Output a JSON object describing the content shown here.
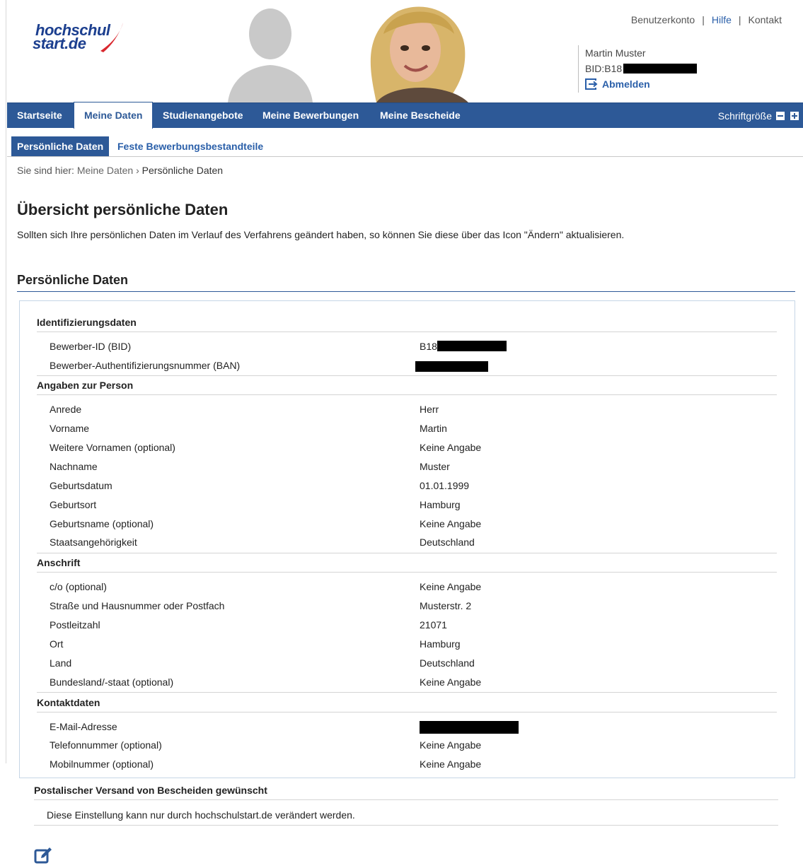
{
  "header": {
    "logo_line1": "hochschul",
    "logo_line2": "start.de",
    "links": {
      "account": "Benutzerkonto",
      "help": "Hilfe",
      "contact": "Kontakt"
    },
    "user_name": "Martin Muster",
    "bid_label": "BID:B18",
    "logout": "Abmelden"
  },
  "main_nav": {
    "items": [
      "Startseite",
      "Meine Daten",
      "Studienangebote",
      "Meine Bewerbungen",
      "Meine Bescheide"
    ],
    "active": "Meine Daten",
    "font_size_label": "Schriftgröße"
  },
  "sub_nav": {
    "items": [
      "Persönliche Daten",
      "Feste Bewerbungsbestandteile"
    ],
    "active": "Persönliche Daten"
  },
  "breadcrumb": {
    "prefix": "Sie sind hier:",
    "parent": "Meine Daten",
    "separator": "›",
    "current": "Persönliche Daten"
  },
  "page": {
    "title": "Übersicht persönliche Daten",
    "intro": "Sollten sich Ihre persönlichen Daten im Verlauf des Verfahrens geändert haben, so können Sie diese über das Icon \"Ändern\" aktualisieren."
  },
  "section_title": "Persönliche Daten",
  "groups": [
    {
      "title": "Identifizierungsdaten",
      "rows": [
        {
          "label": "Bewerber-ID (BID)",
          "value": "B18"
        },
        {
          "label": "Bewerber-Authentifizierungsnummer (BAN)",
          "value": ""
        }
      ]
    },
    {
      "title": "Angaben zur Person",
      "rows": [
        {
          "label": "Anrede",
          "value": "Herr"
        },
        {
          "label": "Vorname",
          "value": "Martin"
        },
        {
          "label": "Weitere Vornamen (optional)",
          "value": "Keine Angabe"
        },
        {
          "label": "Nachname",
          "value": "Muster"
        },
        {
          "label": "Geburtsdatum",
          "value": "01.01.1999"
        },
        {
          "label": "Geburtsort",
          "value": "Hamburg"
        },
        {
          "label": "Geburtsname (optional)",
          "value": "Keine Angabe"
        },
        {
          "label": "Staatsangehörigkeit",
          "value": "Deutschland"
        }
      ]
    },
    {
      "title": "Anschrift",
      "rows": [
        {
          "label": "c/o (optional)",
          "value": "Keine Angabe"
        },
        {
          "label": "Straße und Hausnummer oder Postfach",
          "value": "Musterstr. 2"
        },
        {
          "label": "Postleitzahl",
          "value": "21071"
        },
        {
          "label": "Ort",
          "value": "Hamburg"
        },
        {
          "label": "Land",
          "value": "Deutschland"
        },
        {
          "label": "Bundesland/-staat (optional)",
          "value": "Keine Angabe"
        }
      ]
    },
    {
      "title": "Kontaktdaten",
      "rows": [
        {
          "label": "E-Mail-Adresse",
          "value": ""
        },
        {
          "label": "Telefonnummer (optional)",
          "value": "Keine Angabe"
        },
        {
          "label": "Mobilnummer (optional)",
          "value": "Keine Angabe"
        }
      ]
    }
  ],
  "postal": {
    "title": "Postalischer Versand von Bescheiden gewünscht",
    "text": "Diese Einstellung kann nur durch hochschulstart.de verändert werden."
  },
  "icons": {
    "edit": "edit-icon",
    "logout": "logout-icon"
  },
  "colors": {
    "brand_blue": "#2d5997",
    "link_blue": "#2a5fa9",
    "logo_red": "#d9272e"
  }
}
